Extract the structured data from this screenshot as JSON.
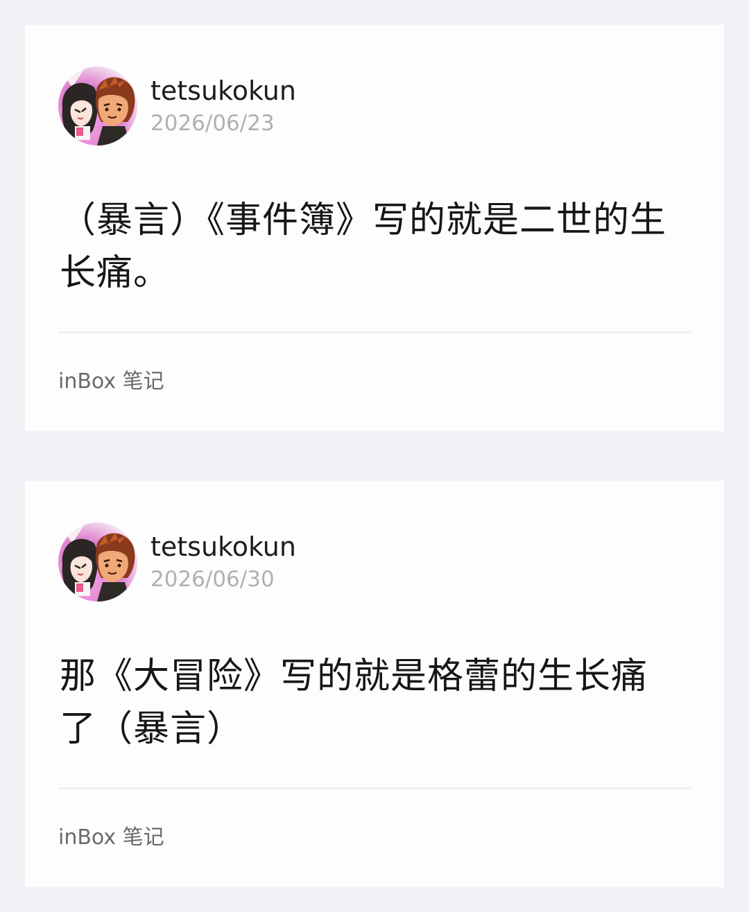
{
  "posts": [
    {
      "username": "tetsukokun",
      "date": "2026/06/23",
      "body": "（暴言）《事件簿》写的就是二世的生长痛。",
      "footer": "inBox 笔记",
      "avatar_icon": "anime-duo-avatar"
    },
    {
      "username": "tetsukokun",
      "date": "2026/06/30",
      "body": "那《大冒险》写的就是格蕾的生长痛了（暴言）",
      "footer": "inBox 笔记",
      "avatar_icon": "anime-duo-avatar"
    }
  ],
  "colors": {
    "page_background": "#f2f1f6",
    "card_background": "#fdfdfd",
    "username": "#1c1c1e",
    "date": "#b0b0b3",
    "footer": "#6a6a6e"
  }
}
